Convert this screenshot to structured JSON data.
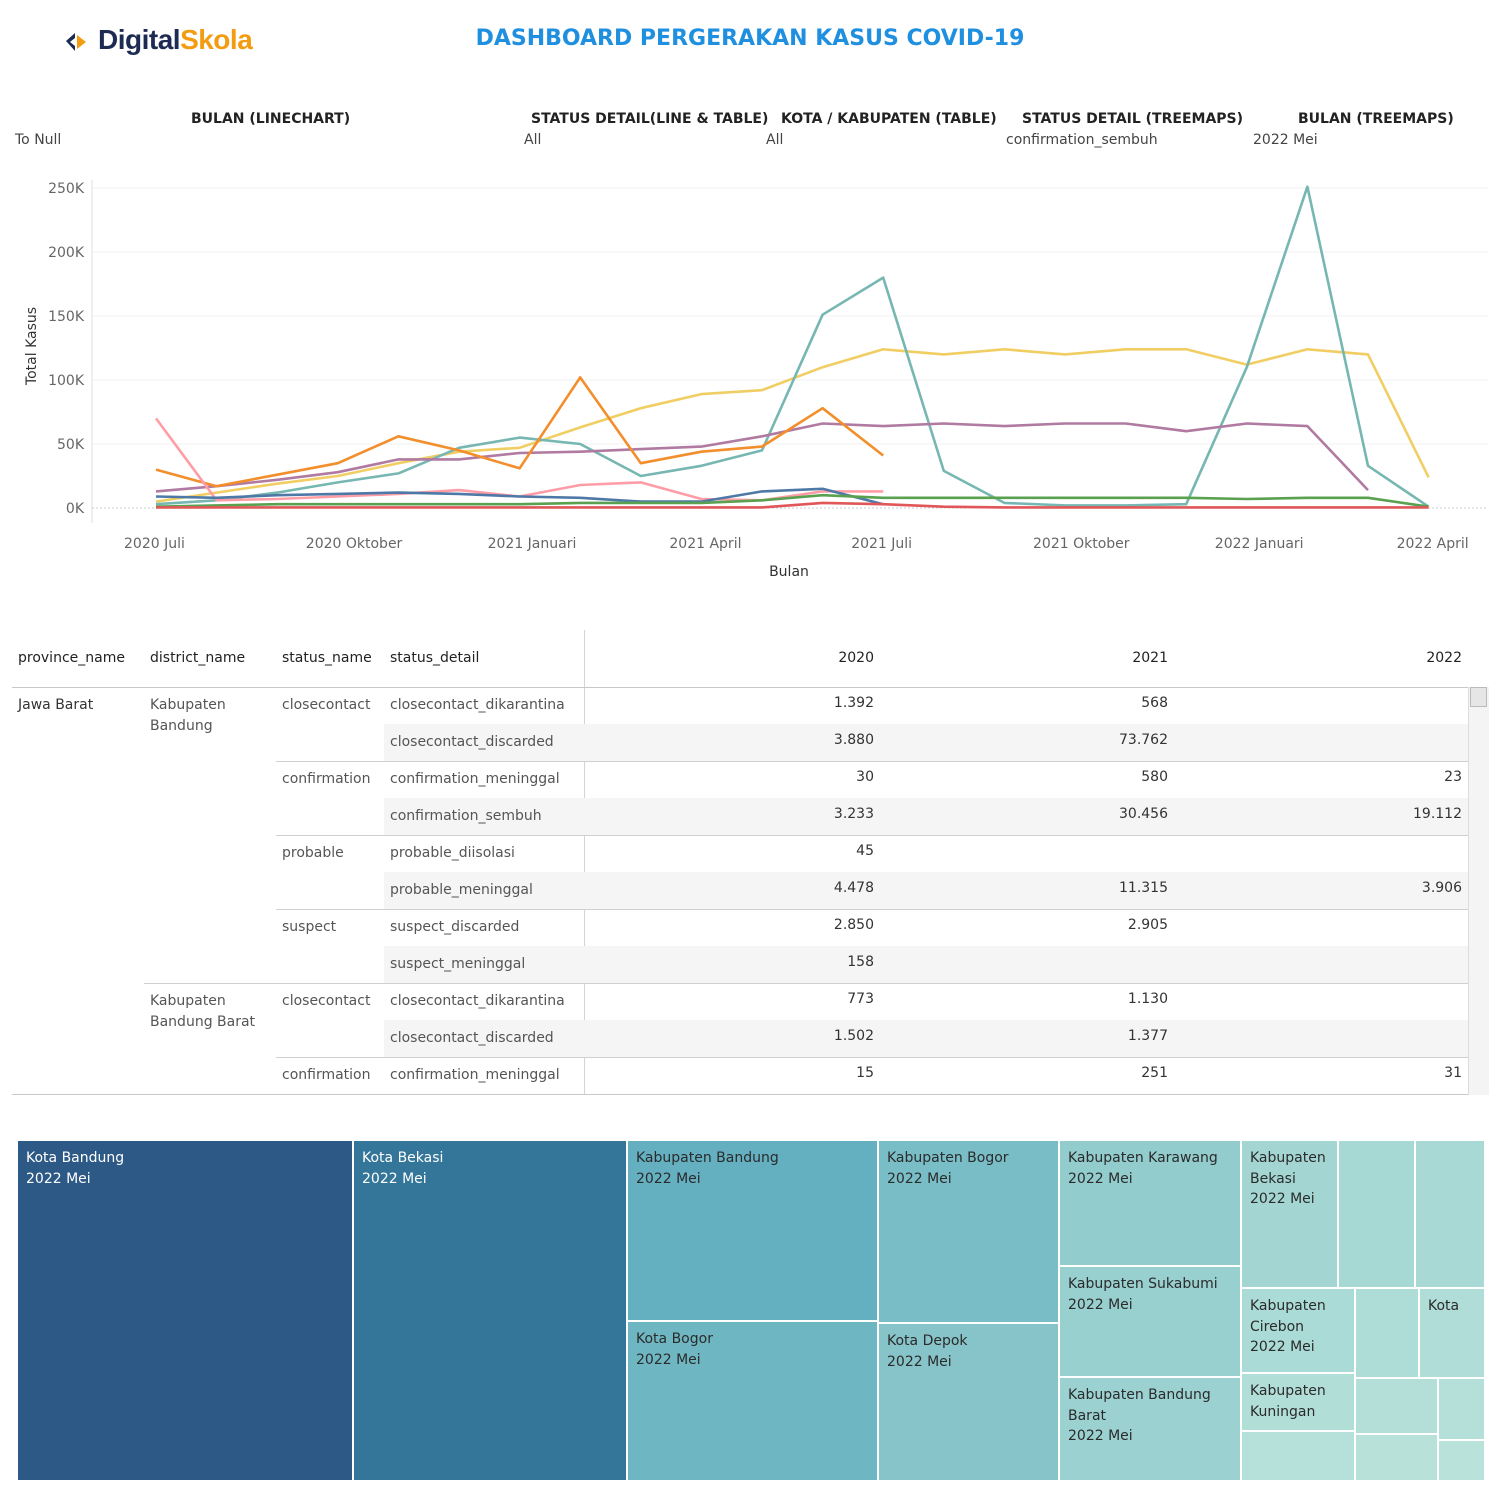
{
  "header": {
    "title": "DASHBOARD PERGERAKAN KASUS COVID-19",
    "logo_text_part1": "Digital",
    "logo_text_part2": "Skola"
  },
  "filters": [
    {
      "label": "BULAN (LINECHART)",
      "value": "To Null"
    },
    {
      "label": "STATUS DETAIL(LINE & TABLE)",
      "value": "All"
    },
    {
      "label": "KOTA / KABUPATEN (TABLE)",
      "value": "All"
    },
    {
      "label": "STATUS DETAIL (TREEMAPS)",
      "value": "confirmation_sembuh"
    },
    {
      "label": "BULAN (TREEMAPS)",
      "value": "2022 Mei"
    }
  ],
  "chart_data": {
    "type": "line",
    "xlabel": "Bulan",
    "ylabel": "Total Kasus",
    "x": [
      "2020-07",
      "2020-08",
      "2020-09",
      "2020-10",
      "2020-11",
      "2020-12",
      "2021-01",
      "2021-02",
      "2021-03",
      "2021-04",
      "2021-05",
      "2021-06",
      "2021-07",
      "2021-08",
      "2021-09",
      "2021-10",
      "2021-11",
      "2021-12",
      "2022-01",
      "2022-02",
      "2022-03",
      "2022-04",
      "2022-05"
    ],
    "x_tick_labels": [
      {
        "month": "2020-07",
        "label": "2020 Juli"
      },
      {
        "month": "2020-10",
        "label": "2020 Oktober"
      },
      {
        "month": "2021-01",
        "label": "2021 Januari"
      },
      {
        "month": "2021-04",
        "label": "2021 April"
      },
      {
        "month": "2021-07",
        "label": "2021 Juli"
      },
      {
        "month": "2021-10",
        "label": "2021 Oktober"
      },
      {
        "month": "2022-01",
        "label": "2022 Januari"
      },
      {
        "month": "2022-04",
        "label": "2022 April"
      }
    ],
    "y_ticks": [
      {
        "value": 0,
        "label": "0K"
      },
      {
        "value": 50000,
        "label": "50K"
      },
      {
        "value": 100000,
        "label": "100K"
      },
      {
        "value": 150000,
        "label": "150K"
      },
      {
        "value": 200000,
        "label": "200K"
      },
      {
        "value": 250000,
        "label": "250K"
      }
    ],
    "ylim": [
      0,
      255000
    ],
    "grid": true,
    "series": [
      {
        "color": "#f1ce63",
        "values": [
          5000,
          12000,
          19000,
          25000,
          35000,
          44000,
          47000,
          63000,
          78000,
          89000,
          92000,
          110000,
          124000,
          120000,
          124000,
          120000,
          124000,
          124000,
          112000,
          124000,
          120000,
          24000,
          null
        ]
      },
      {
        "color": "#76b7b2",
        "values": [
          3000,
          6000,
          12000,
          20000,
          27000,
          47000,
          55000,
          50000,
          25000,
          33000,
          45000,
          151000,
          180000,
          29000,
          4000,
          2000,
          2000,
          3000,
          110000,
          251000,
          33000,
          1000,
          null
        ]
      },
      {
        "color": "#b07aa1",
        "values": [
          13000,
          17000,
          22000,
          28000,
          38000,
          38000,
          43000,
          44000,
          46000,
          48000,
          56000,
          66000,
          64000,
          66000,
          64000,
          66000,
          66000,
          60000,
          66000,
          64000,
          14000,
          null,
          null
        ]
      },
      {
        "color": "#f28e2b",
        "values": [
          30000,
          17000,
          26000,
          35000,
          56000,
          45000,
          31000,
          102000,
          35000,
          44000,
          48000,
          78000,
          41000,
          null,
          null,
          null,
          null,
          null,
          null,
          null,
          null,
          null,
          null
        ]
      },
      {
        "color": "#ff9da7",
        "values": [
          70000,
          6000,
          7000,
          9000,
          11000,
          14000,
          9000,
          18000,
          20000,
          7000,
          6000,
          13000,
          13000,
          null,
          null,
          null,
          null,
          null,
          null,
          null,
          null,
          null,
          null
        ]
      },
      {
        "color": "#4e79a7",
        "values": [
          9000,
          8000,
          10000,
          11000,
          12000,
          11000,
          9000,
          8000,
          5000,
          5000,
          13000,
          15000,
          3000,
          null,
          null,
          null,
          null,
          null,
          null,
          null,
          null,
          null,
          null
        ]
      },
      {
        "color": "#59a14f",
        "values": [
          1000,
          2000,
          3000,
          3000,
          3000,
          3000,
          3000,
          4000,
          4000,
          4000,
          6000,
          10000,
          8000,
          8000,
          8000,
          8000,
          8000,
          8000,
          7000,
          8000,
          8000,
          1000,
          null
        ]
      },
      {
        "color": "#e15759",
        "values": [
          500,
          500,
          500,
          500,
          500,
          500,
          500,
          500,
          500,
          500,
          500,
          4000,
          3000,
          1000,
          500,
          500,
          500,
          500,
          500,
          500,
          500,
          500,
          null
        ]
      }
    ]
  },
  "table": {
    "headers": {
      "province": "province_name",
      "district": "district_name",
      "status_name": "status_name",
      "status_detail": "status_detail",
      "y2020": "2020",
      "y2021": "2021",
      "y2022": "2022"
    },
    "province": "Jawa Barat",
    "districts": [
      {
        "line1": "Kabupaten",
        "line2": "Bandung"
      },
      {
        "line1": "Kabupaten",
        "line2": "Bandung Barat"
      }
    ],
    "status_groups": [
      "closecontact",
      "confirmation",
      "probable",
      "suspect",
      "closecontact",
      "confirmation"
    ],
    "rows": [
      {
        "detail": "closecontact_dikarantina",
        "y2020": "1.392",
        "y2021": "568",
        "y2022": ""
      },
      {
        "detail": "closecontact_discarded",
        "y2020": "3.880",
        "y2021": "73.762",
        "y2022": ""
      },
      {
        "detail": "confirmation_meninggal",
        "y2020": "30",
        "y2021": "580",
        "y2022": "23"
      },
      {
        "detail": "confirmation_sembuh",
        "y2020": "3.233",
        "y2021": "30.456",
        "y2022": "19.112"
      },
      {
        "detail": "probable_diisolasi",
        "y2020": "45",
        "y2021": "",
        "y2022": ""
      },
      {
        "detail": "probable_meninggal",
        "y2020": "4.478",
        "y2021": "11.315",
        "y2022": "3.906"
      },
      {
        "detail": "suspect_discarded",
        "y2020": "2.850",
        "y2021": "2.905",
        "y2022": ""
      },
      {
        "detail": "suspect_meninggal",
        "y2020": "158",
        "y2021": "",
        "y2022": ""
      },
      {
        "detail": "closecontact_dikarantina",
        "y2020": "773",
        "y2021": "1.130",
        "y2022": ""
      },
      {
        "detail": "closecontact_discarded",
        "y2020": "1.502",
        "y2021": "1.377",
        "y2022": ""
      },
      {
        "detail": "confirmation_meninggal",
        "y2020": "15",
        "y2021": "251",
        "y2022": "31"
      }
    ]
  },
  "treemap": {
    "tiles": [
      {
        "name": "Kota Bandung",
        "month": "2022 Mei",
        "color": "#2c5985"
      },
      {
        "name": "Kota Bekasi",
        "month": "2022 Mei",
        "color": "#347699"
      },
      {
        "name": "Kabupaten Bandung",
        "month": "2022 Mei",
        "color": "#64afc0"
      },
      {
        "name": "Kota Bogor",
        "month": "2022 Mei",
        "color": "#6fb6c3"
      },
      {
        "name": "Kabupaten Bogor",
        "month": "2022 Mei",
        "color": "#79bdc6"
      },
      {
        "name": "Kota Depok",
        "month": "2022 Mei",
        "color": "#86c4c9"
      },
      {
        "name": "Kabupaten Karawang",
        "month": "2022 Mei",
        "color": "#93cccd"
      },
      {
        "name": "Kabupaten Sukabumi",
        "month": "2022 Mei",
        "color": "#98cfcf"
      },
      {
        "name": "Kabupaten Bandung Barat",
        "month": "2022 Mei",
        "color": "#9bd1d0"
      },
      {
        "name": "Kabupaten Bekasi",
        "month": "2022 Mei",
        "color": "#a3d6d3"
      },
      {
        "name": "",
        "month": "",
        "color": "#a6d8d4"
      },
      {
        "name": "",
        "month": "",
        "color": "#a8d9d5"
      },
      {
        "name": "Kabupaten Cirebon",
        "month": "2022 Mei",
        "color": "#abdbd6"
      },
      {
        "name": "",
        "month": "",
        "color": "#aedcd7"
      },
      {
        "name": "Kota",
        "month": "",
        "color": "#b0ddd7"
      },
      {
        "name": "Kabupaten Kuningan",
        "month": "",
        "color": "#b2ded8"
      },
      {
        "name": "",
        "month": "",
        "color": "#b4dfd9"
      },
      {
        "name": "",
        "month": "",
        "color": "#b5e0d9"
      },
      {
        "name": "",
        "month": "",
        "color": "#b6e0da"
      },
      {
        "name": "",
        "month": "",
        "color": "#b8e1da"
      },
      {
        "name": "",
        "month": "",
        "color": "#b9e2db"
      }
    ]
  }
}
